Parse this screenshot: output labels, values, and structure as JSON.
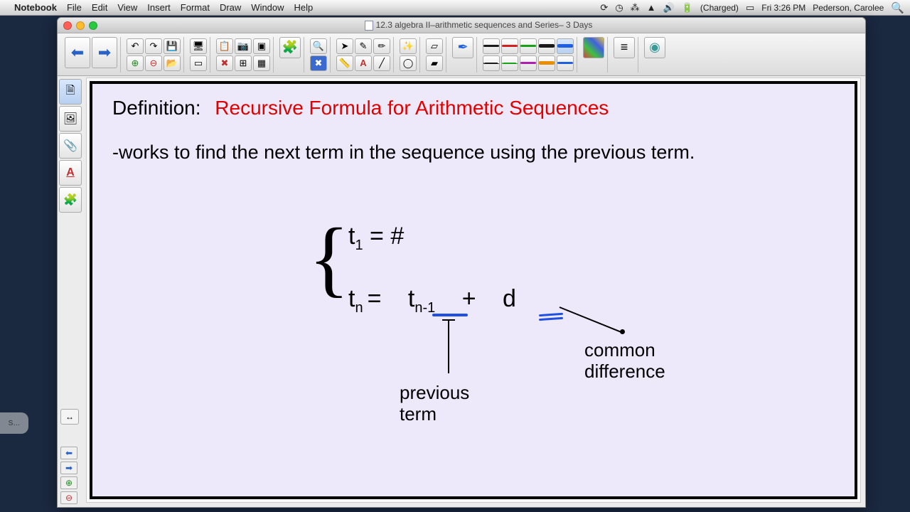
{
  "menubar": {
    "app": "Notebook",
    "items": [
      "File",
      "Edit",
      "View",
      "Insert",
      "Format",
      "Draw",
      "Window",
      "Help"
    ],
    "battery": "(Charged)",
    "clock": "Fri 3:26 PM",
    "user": "Pederson, Carolee"
  },
  "window": {
    "title": "12.3 algebra II–arithmetic sequences and Series– 3 Days"
  },
  "slide": {
    "def_label": "Definition:",
    "def_title": "Recursive Formula for Arithmetic Sequences",
    "description": "-works to find the next term in the sequence using the previous term.",
    "formula_line1_left": "t",
    "formula_line1_sub": "1",
    "formula_line1_rest": "  =  #",
    "formula_line2_a": "t",
    "formula_line2_a_sub": "n",
    "formula_line2_eq": "=",
    "formula_line2_b": "t",
    "formula_line2_b_sub": "n-1",
    "formula_line2_plus": "+",
    "formula_line2_d": "d",
    "ann_prev": "previous\nterm",
    "ann_common": "common\ndifference"
  },
  "pen_colors": [
    "#1a1a1a",
    "#d02020",
    "#18a018",
    "#1a1a1a",
    "#2060e0",
    "#1a1a1a",
    "#18a018",
    "#b020b0",
    "#e89000",
    "#2060e0"
  ]
}
